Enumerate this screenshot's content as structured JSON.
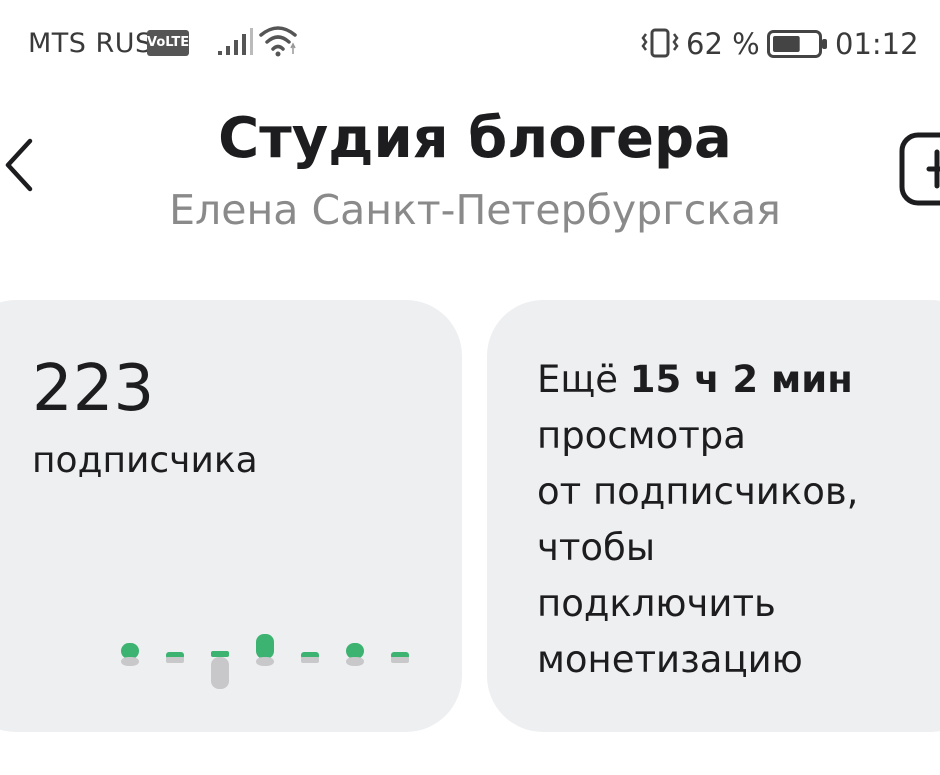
{
  "status_bar": {
    "carrier": "MTS RUS",
    "volte_badge": "VoLTE",
    "battery_percent": "62 %",
    "time": "01:12",
    "signal_bars_active": 4,
    "battery_level": 0.62
  },
  "header": {
    "title": "Студия блогера",
    "subtitle": "Елена Санкт-Петербургская"
  },
  "subscribers_card": {
    "count": "223",
    "label": "подписчика",
    "trend": [
      1,
      0,
      -1,
      2,
      0,
      1,
      0
    ]
  },
  "monetization_card": {
    "prefix": "Ещё",
    "remaining_time": "15 ч 2 мин",
    "line1": "просмотра",
    "line2": "от подписчиков,",
    "line3": "чтобы",
    "line4": "подключить",
    "line5": "монетизацию"
  },
  "colors": {
    "card_background": "#eeeff1",
    "trend_positive": "#3cb371",
    "trend_neutral": "#c8c8ca"
  }
}
